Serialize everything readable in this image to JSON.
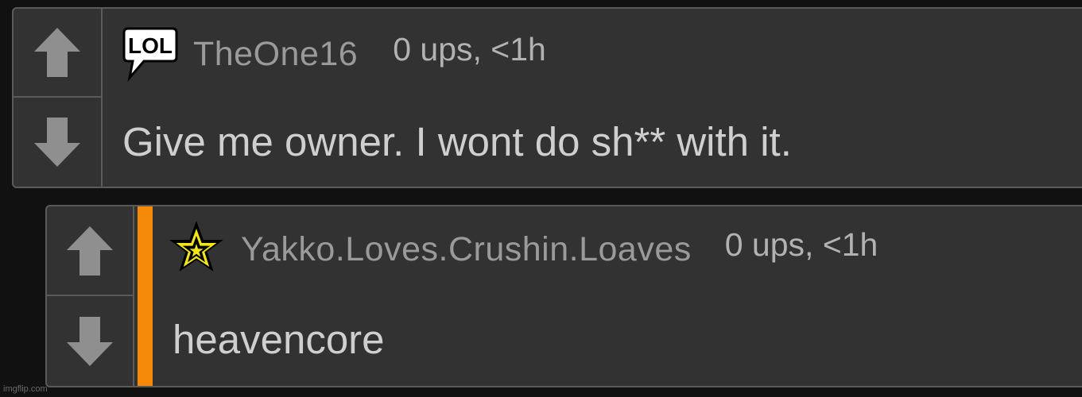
{
  "comments": [
    {
      "username": "TheOne16",
      "meta": "0 ups, <1h",
      "body": "Give me owner. I wont do sh** with it.",
      "badge": {
        "icon": "lol-speech-bubble-icon",
        "text": "LOL"
      }
    },
    {
      "username": "Yakko.Loves.Crushin.Loaves",
      "meta": "0 ups, <1h",
      "body": "heavencore",
      "badge": {
        "icon": "star-icon"
      },
      "accent_color": "#f58a09"
    }
  ],
  "watermark": "imgflip.com"
}
